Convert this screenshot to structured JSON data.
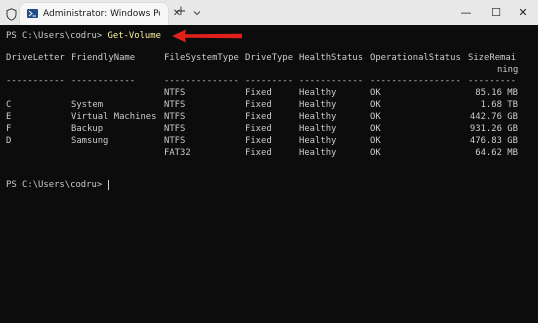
{
  "tab": {
    "title": "Administrator: Windows PowerShell",
    "close_glyph": "✕",
    "new_tab_glyph": "+"
  },
  "window_controls": {
    "minimize": "—",
    "maximize": "☐",
    "close": "✕"
  },
  "terminal": {
    "prompt": "PS C:\\Users\\codru> ",
    "command": "Get-Volume",
    "headers": {
      "drive_letter": "DriveLetter",
      "friendly_name": "FriendlyName",
      "file_system_type": "FileSystemType",
      "drive_type": "DriveType",
      "health_status": "HealthStatus",
      "operational_status": "OperationalStatus",
      "size_remaining_1": "SizeRemai",
      "size_remaining_2": "ning"
    },
    "separators": {
      "drive_letter": "-----------",
      "friendly_name": "------------",
      "file_system_type": "--------------",
      "drive_type": "---------",
      "health_status": "------------",
      "operational_status": "-----------------",
      "size_remaining": "---------"
    },
    "rows": [
      {
        "drive": "",
        "name": "",
        "fs": "NTFS",
        "type": "Fixed",
        "health": "Healthy",
        "op": "OK",
        "size": "85.16 MB"
      },
      {
        "drive": "C",
        "name": "System",
        "fs": "NTFS",
        "type": "Fixed",
        "health": "Healthy",
        "op": "OK",
        "size": "1.68 TB"
      },
      {
        "drive": "E",
        "name": "Virtual Machines",
        "fs": "NTFS",
        "type": "Fixed",
        "health": "Healthy",
        "op": "OK",
        "size": "442.76 GB"
      },
      {
        "drive": "F",
        "name": "Backup",
        "fs": "NTFS",
        "type": "Fixed",
        "health": "Healthy",
        "op": "OK",
        "size": "931.26 GB"
      },
      {
        "drive": "D",
        "name": "Samsung",
        "fs": "NTFS",
        "type": "Fixed",
        "health": "Healthy",
        "op": "OK",
        "size": "476.83 GB"
      },
      {
        "drive": "",
        "name": "",
        "fs": "FAT32",
        "type": "Fixed",
        "health": "Healthy",
        "op": "OK",
        "size": "64.62 MB"
      }
    ],
    "final_prompt": "PS C:\\Users\\codru> "
  },
  "colors": {
    "background": "#0c0c0c",
    "text": "#cccccc",
    "command": "#f9f1a5",
    "arrow": "#e0201b",
    "titlebar": "#e8e8e8"
  },
  "icons": {
    "shield": "shield-icon",
    "terminal": "powershell-icon",
    "chevron": "chevron-down-icon"
  }
}
